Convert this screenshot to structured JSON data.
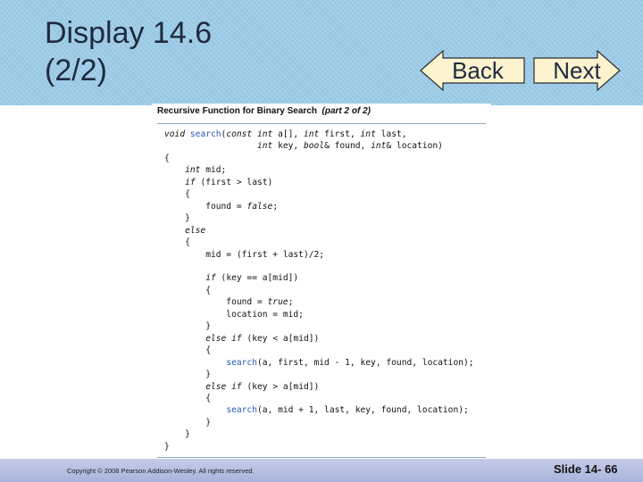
{
  "slide": {
    "title_line1": "Display 14.6",
    "title_line2": "(2/2)"
  },
  "nav": {
    "back_label": "Back",
    "next_label": "Next"
  },
  "code_panel": {
    "heading_main": "Recursive Function for Binary Search",
    "heading_part": "(part 2 of 2)",
    "lines": [
      [
        [
          "k",
          "void "
        ],
        [
          "f",
          "search"
        ],
        [
          "n",
          "("
        ],
        [
          "k",
          "const int "
        ],
        [
          "n",
          "a[], "
        ],
        [
          "k",
          "int "
        ],
        [
          "n",
          "first, "
        ],
        [
          "k",
          "int "
        ],
        [
          "n",
          "last,"
        ]
      ],
      [
        [
          "n",
          "                  "
        ],
        [
          "k",
          "int "
        ],
        [
          "n",
          "key, "
        ],
        [
          "k",
          "bool"
        ],
        [
          "n",
          "& found, "
        ],
        [
          "k",
          "int"
        ],
        [
          "n",
          "& location)"
        ]
      ],
      [
        [
          "n",
          "{"
        ]
      ],
      [
        [
          "n",
          "    "
        ],
        [
          "k",
          "int "
        ],
        [
          "n",
          "mid;"
        ]
      ],
      [
        [
          "n",
          "    "
        ],
        [
          "k",
          "if "
        ],
        [
          "n",
          "(first > last)"
        ]
      ],
      [
        [
          "n",
          "    {"
        ]
      ],
      [
        [
          "n",
          "        found = "
        ],
        [
          "k",
          "false"
        ],
        [
          "n",
          ";"
        ]
      ],
      [
        [
          "n",
          "    }"
        ]
      ],
      [
        [
          "n",
          "    "
        ],
        [
          "k",
          "else"
        ]
      ],
      [
        [
          "n",
          "    {"
        ]
      ],
      [
        [
          "n",
          "        mid = (first + last)/2;"
        ]
      ],
      [
        [
          "n",
          ""
        ]
      ],
      [
        [
          "n",
          "        "
        ],
        [
          "k",
          "if "
        ],
        [
          "n",
          "(key == a[mid])"
        ]
      ],
      [
        [
          "n",
          "        {"
        ]
      ],
      [
        [
          "n",
          "            found = "
        ],
        [
          "k",
          "true"
        ],
        [
          "n",
          ";"
        ]
      ],
      [
        [
          "n",
          "            location = mid;"
        ]
      ],
      [
        [
          "n",
          "        }"
        ]
      ],
      [
        [
          "n",
          "        "
        ],
        [
          "k",
          "else if "
        ],
        [
          "n",
          "(key < a[mid])"
        ]
      ],
      [
        [
          "n",
          "        {"
        ]
      ],
      [
        [
          "n",
          "            "
        ],
        [
          "f",
          "search"
        ],
        [
          "n",
          "(a, first, mid - 1, key, found, location);"
        ]
      ],
      [
        [
          "n",
          "        }"
        ]
      ],
      [
        [
          "n",
          "        "
        ],
        [
          "k",
          "else if "
        ],
        [
          "n",
          "(key > a[mid])"
        ]
      ],
      [
        [
          "n",
          "        {"
        ]
      ],
      [
        [
          "n",
          "            "
        ],
        [
          "f",
          "search"
        ],
        [
          "n",
          "(a, mid + 1, last, key, found, location);"
        ]
      ],
      [
        [
          "n",
          "        }"
        ]
      ],
      [
        [
          "n",
          "    }"
        ]
      ],
      [
        [
          "n",
          "}"
        ]
      ]
    ]
  },
  "footer": {
    "copyright": "Copyright © 2008 Pearson Addison-Wesley.  All rights reserved.",
    "slide_number": "Slide 14- 66"
  },
  "colors": {
    "header_bg": "#9ccbe6",
    "button_fill": "#fdf3cf",
    "keyword_blue": "#2457b8",
    "footer_bg": "#b3bce0"
  }
}
